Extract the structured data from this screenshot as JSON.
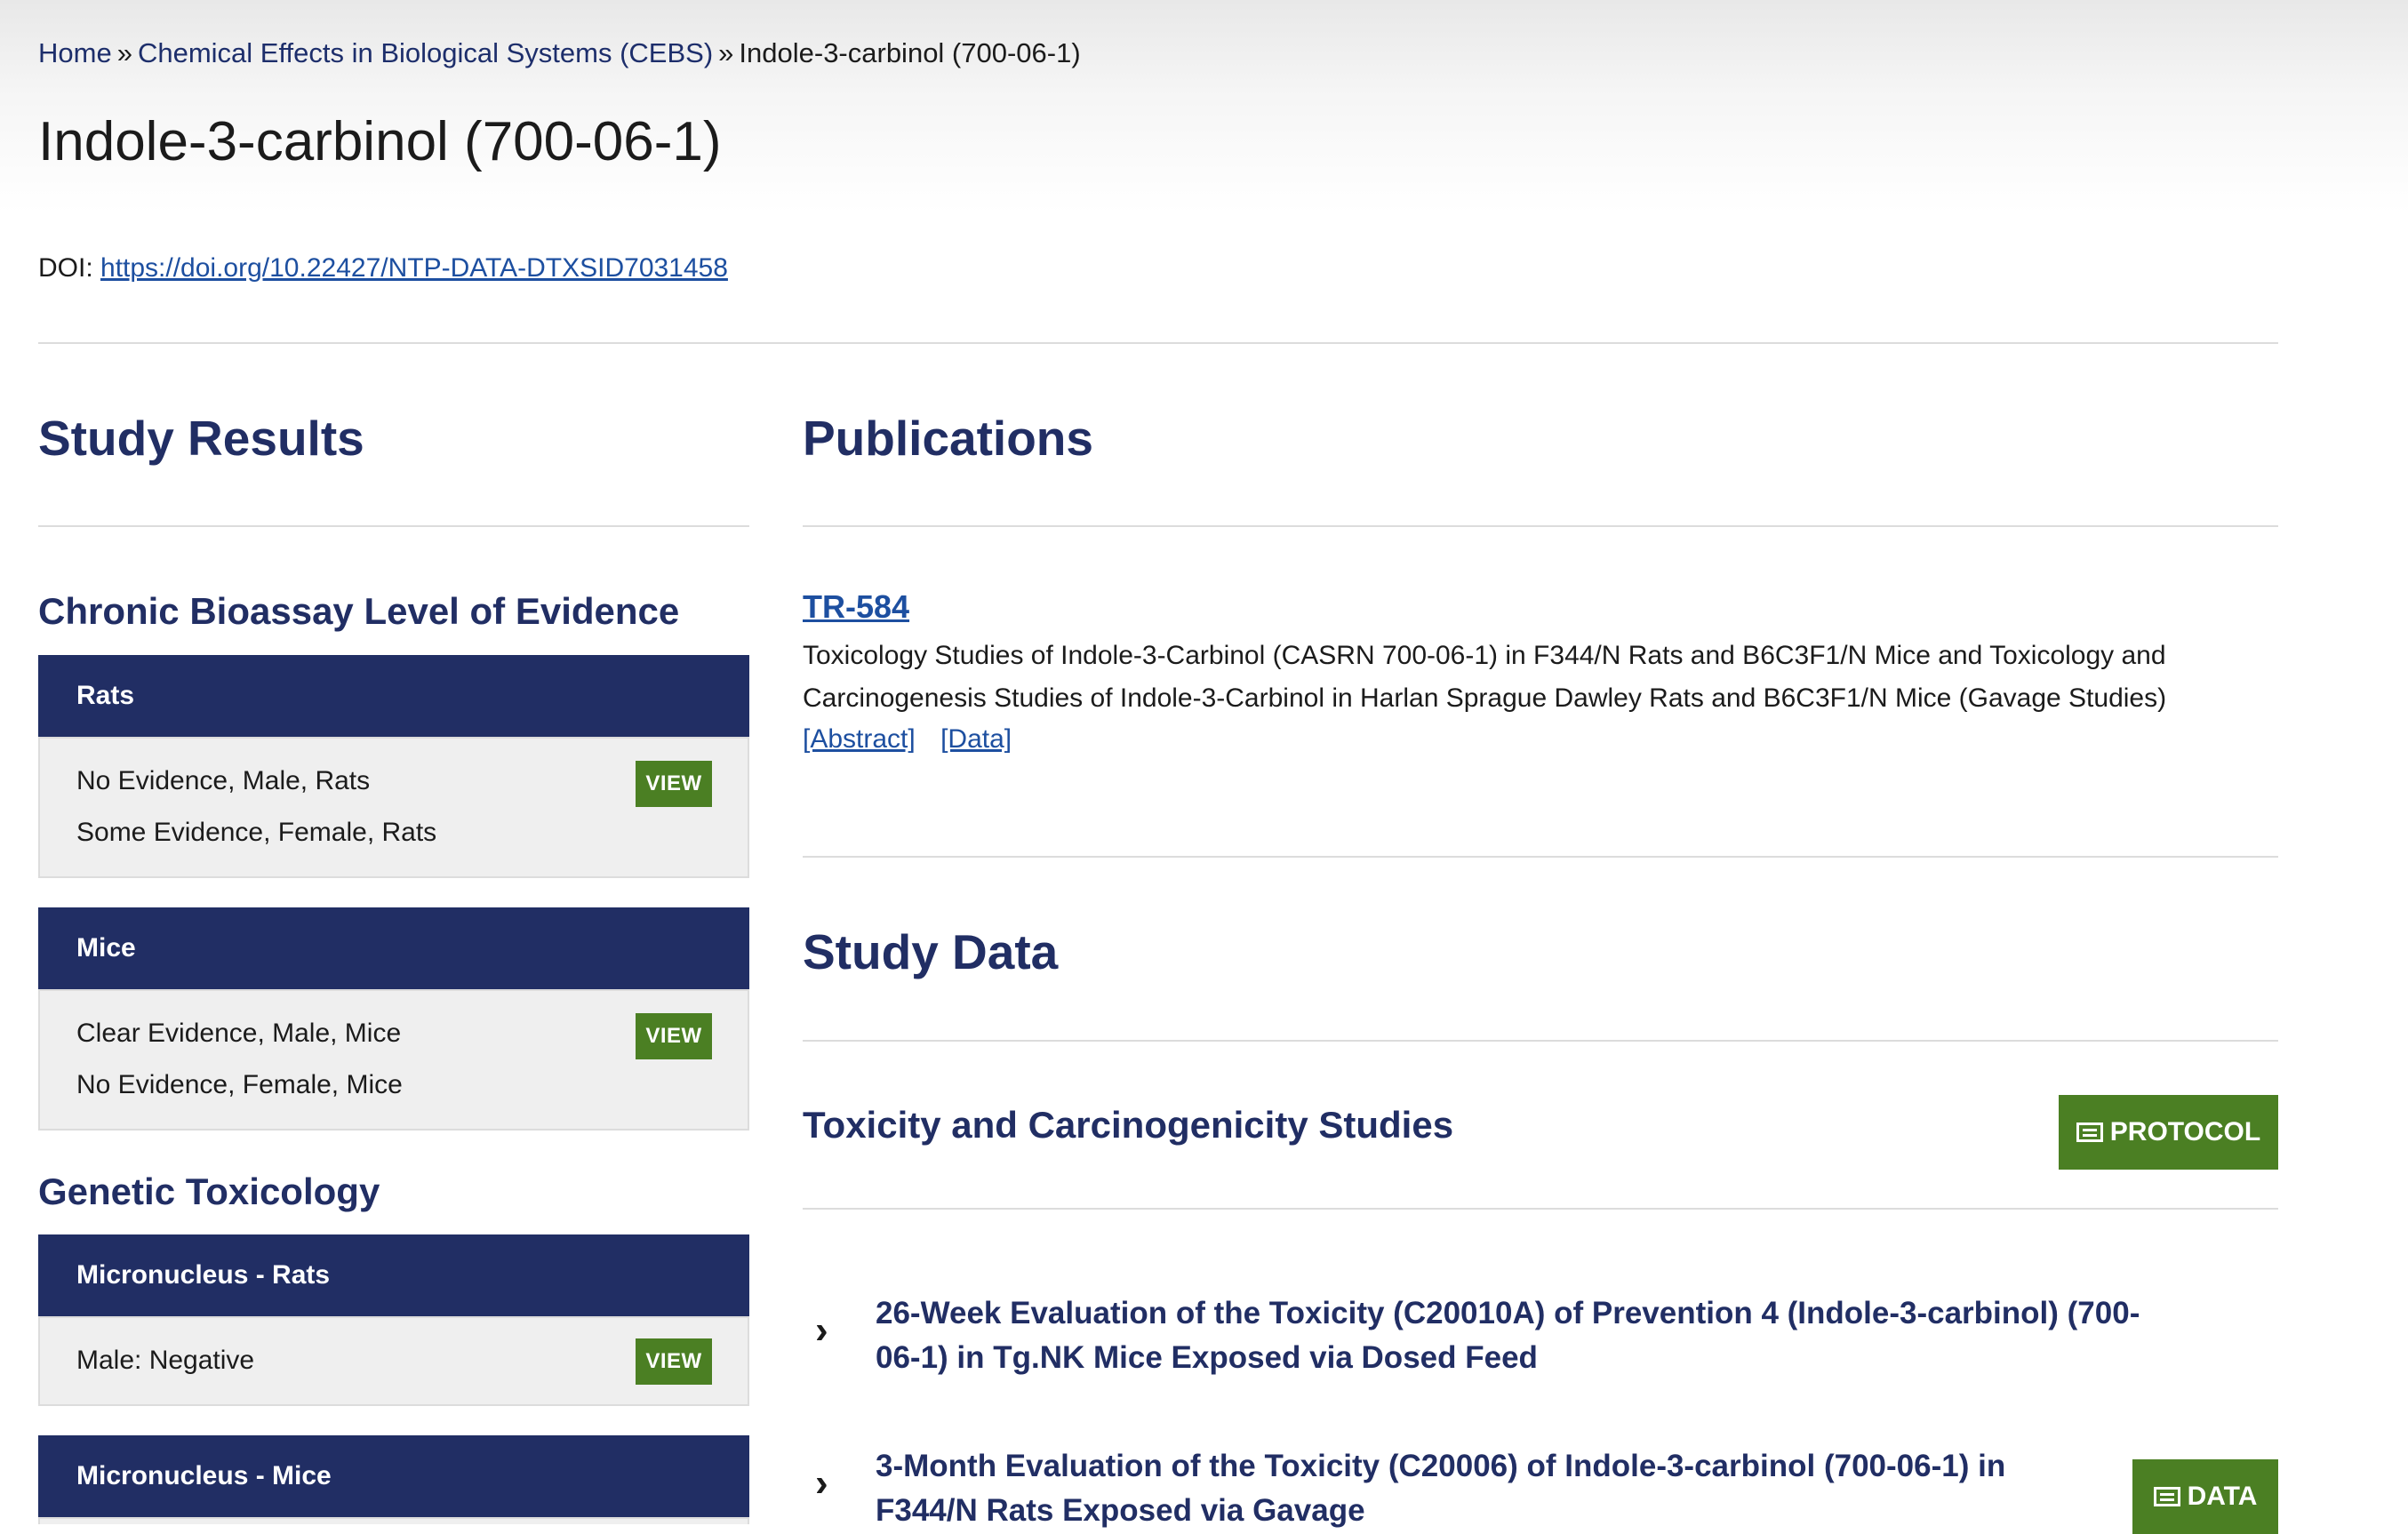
{
  "breadcrumb": {
    "home": "Home",
    "sep": "»",
    "cebs": "Chemical Effects in Biological Systems (CEBS)",
    "current": "Indole-3-carbinol (700-06-1)"
  },
  "page": {
    "title": "Indole-3-carbinol (700-06-1)",
    "doi_label": "DOI:",
    "doi_url": "https://doi.org/10.22427/NTP-DATA-DTXSID7031458"
  },
  "study_results": {
    "heading": "Study Results",
    "chronic": {
      "heading": "Chronic Bioassay Level of Evidence",
      "rats": {
        "title": "Rats",
        "rows": [
          "No Evidence, Male, Rats",
          "Some Evidence, Female, Rats"
        ],
        "button": "VIEW"
      },
      "mice": {
        "title": "Mice",
        "rows": [
          "Clear Evidence, Male, Mice",
          "No Evidence, Female, Mice"
        ],
        "button": "VIEW"
      }
    },
    "genetic": {
      "heading": "Genetic Toxicology",
      "micronucleus_rats": {
        "title": "Micronucleus - Rats",
        "rows": [
          "Male: Negative"
        ],
        "button": "VIEW"
      },
      "micronucleus_mice": {
        "title": "Micronucleus - Mice"
      }
    }
  },
  "publications": {
    "heading": "Publications",
    "items": [
      {
        "id": "TR-584",
        "description": "Toxicology Studies of Indole-3-Carbinol (CASRN 700-06-1) in F344/N Rats and B6C3F1/N Mice and Toxicology and Carcinogenesis Studies of Indole-3-Carbinol in Harlan Sprague Dawley Rats and B6C3F1/N Mice (Gavage Studies)",
        "abstract_link": "[Abstract]",
        "data_link": "[Data]"
      }
    ]
  },
  "study_data": {
    "heading": "Study Data",
    "toxicity": {
      "heading": "Toxicity and Carcinogenicity Studies",
      "protocol_button": "PROTOCOL",
      "studies": [
        {
          "title": "26-Week Evaluation of the Toxicity (C20010A) of Prevention 4 (Indole-3-carbinol) (700-06-1) in Tg.NK Mice Exposed via Dosed Feed"
        },
        {
          "title": "3-Month Evaluation of the Toxicity (C20006) of Indole-3-carbinol (700-06-1) in F344/N Rats Exposed via Gavage",
          "button": "DATA"
        }
      ]
    }
  },
  "colors": {
    "navy": "#212e64",
    "green": "#4b7f23",
    "link": "#1d4fa0"
  },
  "icons": {
    "chevron": "chevron-right-icon",
    "table": "table-icon"
  }
}
